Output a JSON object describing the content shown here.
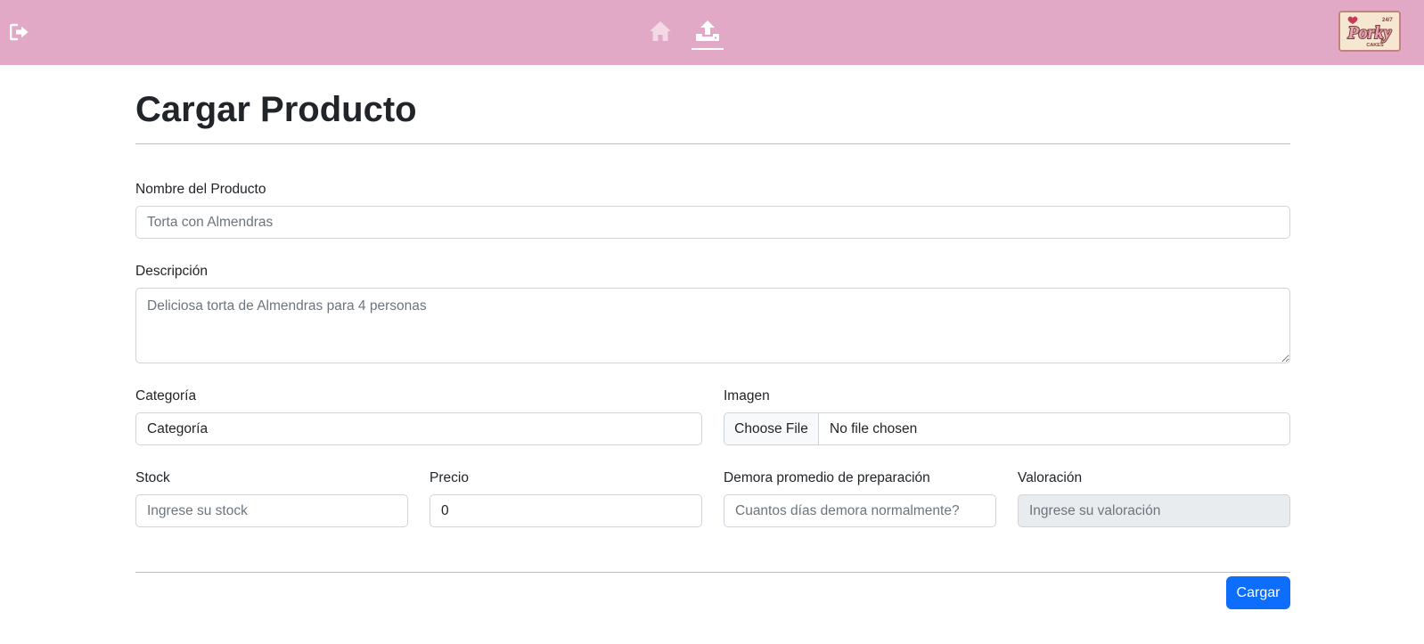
{
  "navbar": {
    "background": "#e1a9c5",
    "icons": [
      "logout-icon",
      "home-icon",
      "upload-icon"
    ],
    "logo": {
      "line1": "Porky",
      "line2": "CAKES",
      "line3": "24/7"
    }
  },
  "page": {
    "title": "Cargar Producto"
  },
  "form": {
    "nombre": {
      "label": "Nombre del Producto",
      "placeholder": "Torta con Almendras"
    },
    "descripcion": {
      "label": "Descripción",
      "placeholder": "Deliciosa torta de Almendras para 4 personas"
    },
    "categoria": {
      "label": "Categoría",
      "value": "Categoría"
    },
    "imagen": {
      "label": "Imagen",
      "button": "Choose File",
      "status": "No file chosen"
    },
    "stock": {
      "label": "Stock",
      "placeholder": "Ingrese su stock"
    },
    "precio": {
      "label": "Precio",
      "value": "0"
    },
    "demora": {
      "label": "Demora promedio de preparación",
      "placeholder": "Cuantos días demora normalmente?"
    },
    "valoracion": {
      "label": "Valoración",
      "placeholder": "Ingrese su valoración"
    },
    "submit": {
      "label": "Cargar",
      "color": "#0d6efd"
    }
  }
}
